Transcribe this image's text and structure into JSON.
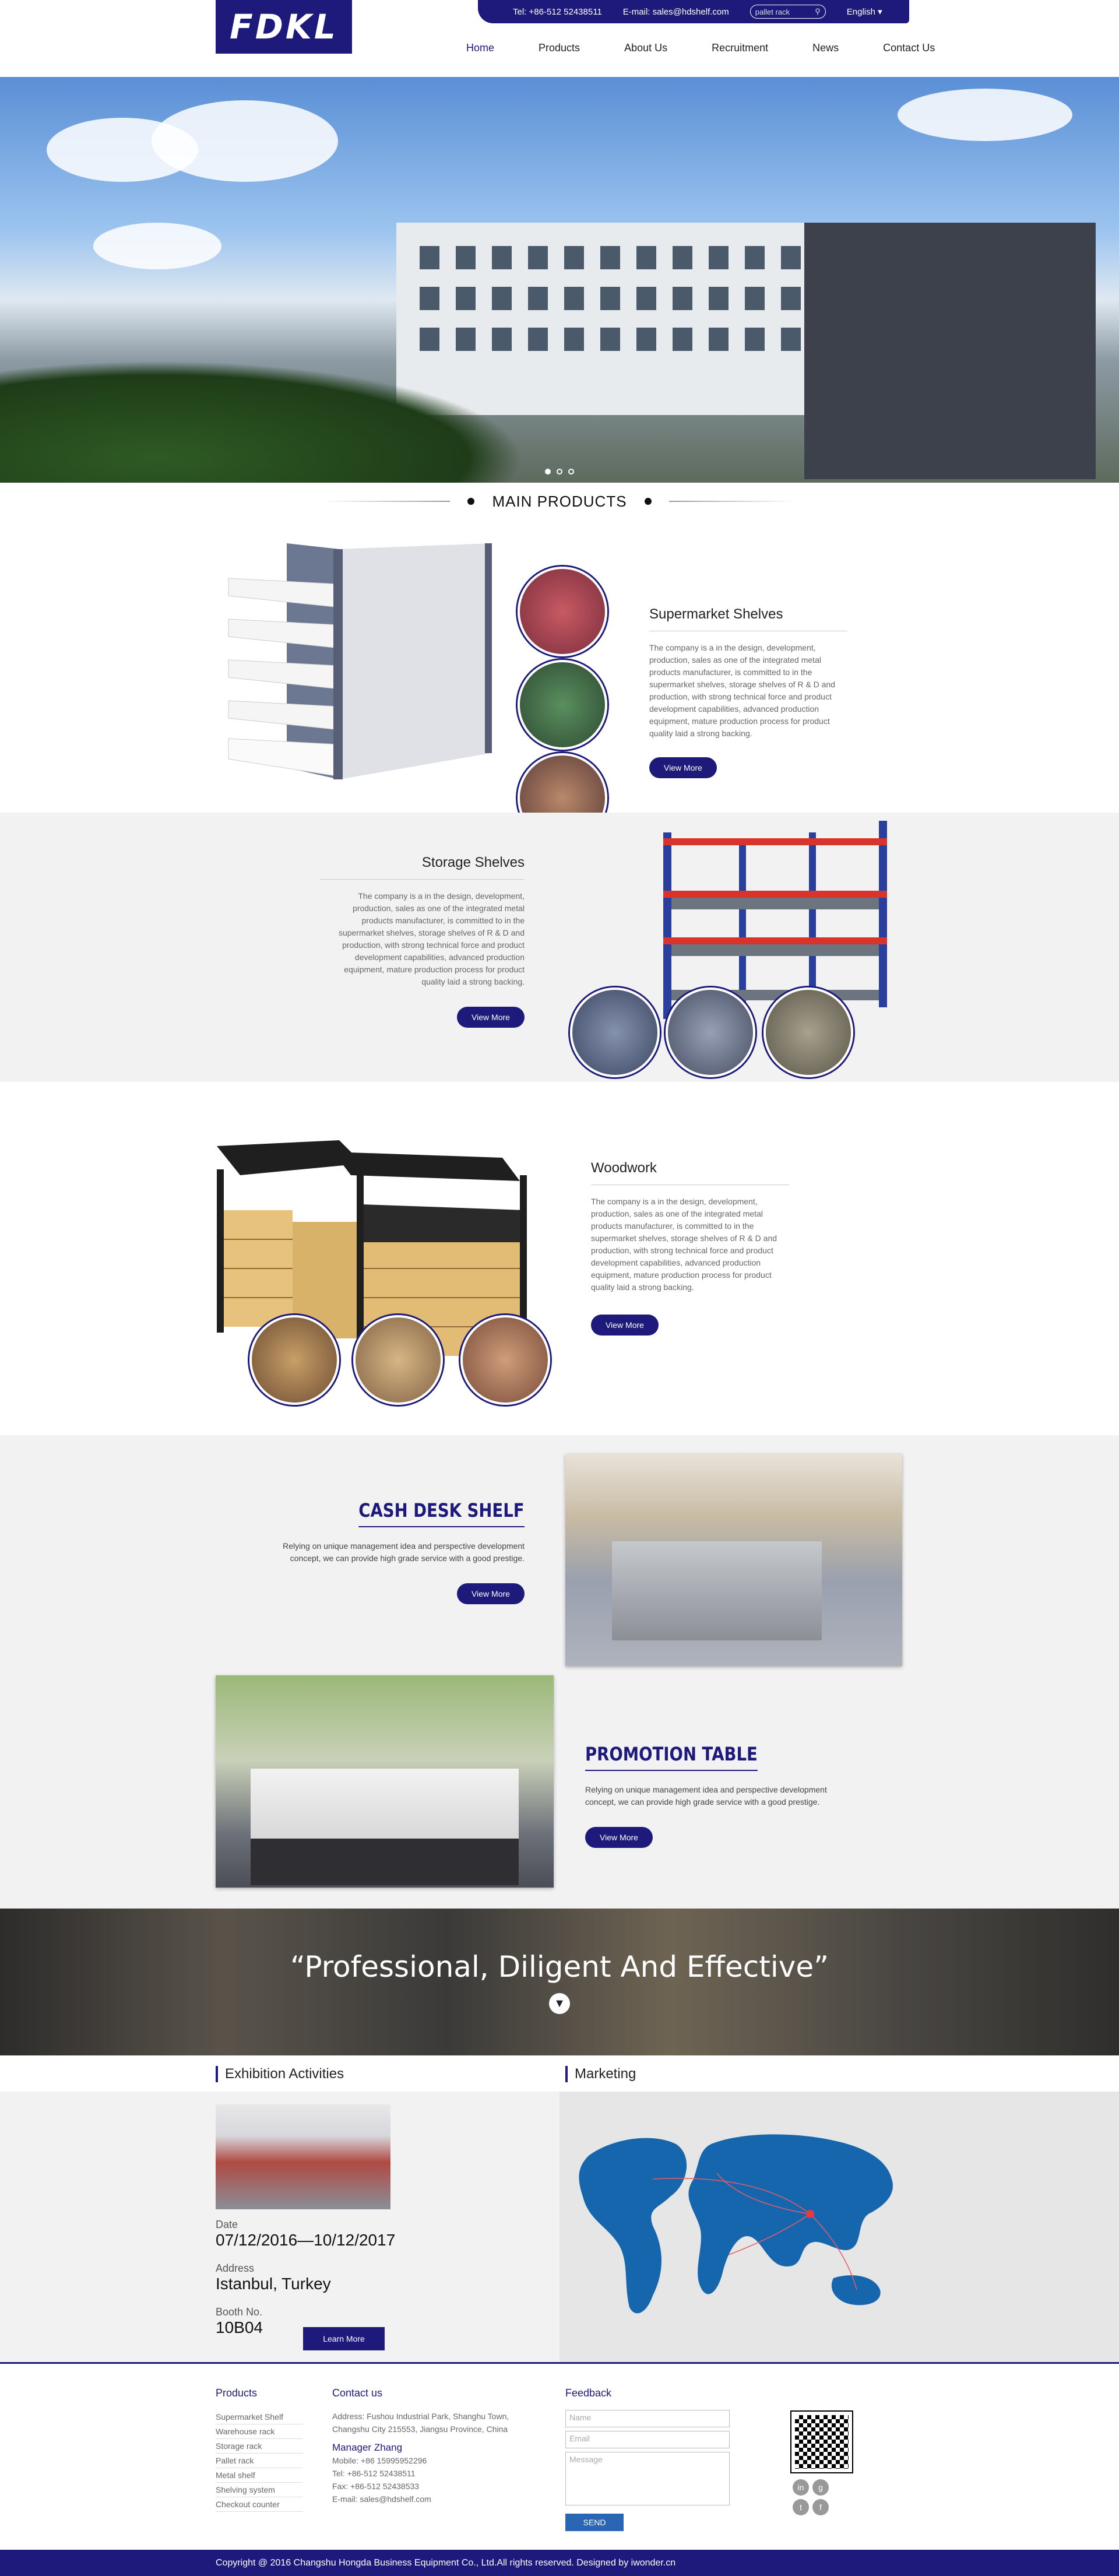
{
  "header": {
    "logo_text": "FDKL",
    "tel": "Tel: +86-512 52438511",
    "email": "E-mail: sales@hdshelf.com",
    "search_placeholder": "pallet rack",
    "language": "English",
    "nav": [
      "Home",
      "Products",
      "About Us",
      "Recruitment",
      "News",
      "Contact Us"
    ]
  },
  "main_products_title": "MAIN PRODUCTS",
  "products": {
    "supermarket": {
      "name": "Supermarket Shelves",
      "desc": "The company is a in the design, development, production, sales as one of the integrated metal products manufacturer, is committed to in the supermarket shelves, storage shelves of R & D and production, with strong technical force and product development capabilities, advanced production equipment, mature production process for product quality laid a strong backing.",
      "button": "View More"
    },
    "storage": {
      "name": "Storage Shelves",
      "desc": "The company is a in the design, development, production, sales as one of the integrated metal products manufacturer, is committed to in the supermarket shelves, storage shelves of R & D and production, with strong technical force and product development capabilities, advanced production equipment, mature production process for product quality laid a strong backing.",
      "button": "View More"
    },
    "woodwork": {
      "name": "Woodwork",
      "desc": "The company is a in the design, development, production, sales as one of the integrated metal products manufacturer, is committed to in the supermarket shelves, storage shelves of R & D and production, with strong technical force and product development capabilities, advanced production equipment, mature production process for product quality laid a strong backing.",
      "button": "View More"
    },
    "cashdesk": {
      "name": "CASH DESK SHELF",
      "desc": "Relying on unique management idea and perspective development concept, we can provide high grade service with a good prestige.",
      "button": "View More"
    },
    "promotion": {
      "name": "PROMOTION TABLE",
      "desc": "Relying on unique management idea and perspective development concept, we can provide high grade service with a good prestige.",
      "button": "View More"
    }
  },
  "banner": {
    "quote": "“Professional, Diligent And Effective”"
  },
  "exhibition": {
    "title": "Exhibition Activities",
    "date_label": "Date",
    "date_value": "07/12/2016—10/12/2017",
    "address_label": "Address",
    "address_value": "Istanbul, Turkey",
    "booth_label": "Booth No.",
    "booth_value": "10B04",
    "button": "Learn More"
  },
  "marketing": {
    "title": "Marketing"
  },
  "footer": {
    "products_title": "Products",
    "products": [
      "Supermarket Shelf",
      "Warehouse rack",
      "Storage rack",
      "Pallet rack",
      "Metal shelf",
      "Shelving system",
      "Checkout counter"
    ],
    "contact_title": "Contact us",
    "address": "Address: Fushou Industrial Park, Shanghu Town, Changshu City 215553, Jiangsu Province, China",
    "manager": "Manager Zhang",
    "mobile": "Mobile: +86 15995952296",
    "tel": "Tel: +86-512 52438511",
    "fax": "Fax: +86-512 52438533",
    "email": "E-mail: sales@hdshelf.com",
    "feedback_title": "Feedback",
    "name_placeholder": "Name",
    "email_placeholder": "Email",
    "message_placeholder": "Message",
    "send": "SEND",
    "copyright": "Copyright @ 2016 Changshu Hongda Business Equipment Co., Ltd.All rights reserved. Designed by iwonder.cn"
  },
  "colors": {
    "brand": "#1d1a7c",
    "gray_bg": "#f2f2f2"
  }
}
